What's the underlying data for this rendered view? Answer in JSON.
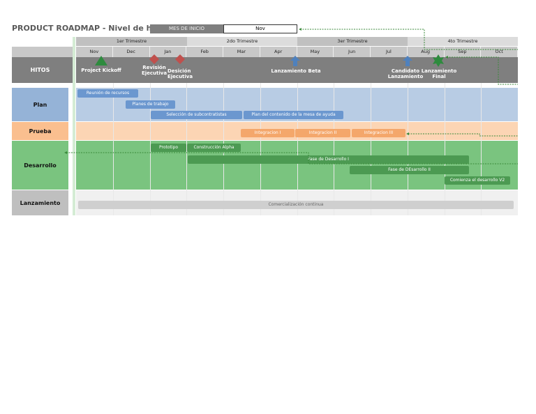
{
  "header": {
    "title": "PRODUCT ROADMAP - Nivel de hitos",
    "start_label": "MES DE INICIO",
    "start_value": "Nov"
  },
  "quarters": [
    "1er Trimestre",
    "2do Trimestre",
    "3er Trimestre",
    "4to Trimestre"
  ],
  "months": [
    "Nov",
    "Dec",
    "Jan",
    "Feb",
    "Mar",
    "Apr",
    "May",
    "Jun",
    "Jul",
    "Aug",
    "Sep",
    "Oct"
  ],
  "rows": {
    "hitos": "HITOS",
    "plan": "Plan",
    "prueba": "Prueba",
    "desarrollo": "Desarrollo",
    "lanzamiento": "Lanzamiento"
  },
  "milestones": [
    {
      "label": "Project Kickoff",
      "icon": "triangle",
      "color": "#2e8b3e"
    },
    {
      "label": "Revisión Ejecutiva",
      "icon": "diamond",
      "color": "#c0504d"
    },
    {
      "label": "Desición Ejecutiva",
      "icon": "diamond",
      "color": "#c0504d"
    },
    {
      "label": "Lanzamiento Beta",
      "icon": "arrow-up",
      "color": "#4f81bd"
    },
    {
      "label": "Candidato Lanzamiento",
      "icon": "arrow-up",
      "color": "#4f81bd"
    },
    {
      "label": "Lanzamiento Final",
      "icon": "star",
      "color": "#2e8b3e"
    }
  ],
  "tasks": {
    "plan": [
      "Reunión de recursos",
      "Planes de trabajo",
      "Selección de subcontratistas",
      "Plan del contenido de la mesa de ayuda"
    ],
    "prueba": [
      "Integracion I",
      "Integracion II",
      "Integracion III"
    ],
    "desarrollo": [
      "Prototipo",
      "Construcción Alpha",
      "Fase de Desarrollo I",
      "Fase de DEsarrollo II",
      "Comienza el desarrollo V2"
    ],
    "lanzamiento": [
      "Comercialización continua"
    ]
  }
}
